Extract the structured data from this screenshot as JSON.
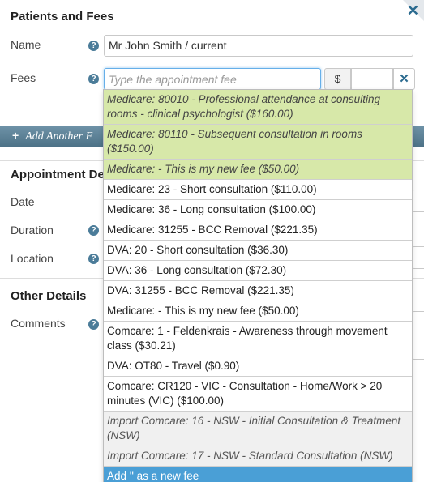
{
  "panel": {
    "title": "Patients and Fees",
    "close_icon": "close-icon"
  },
  "name_field": {
    "label": "Name",
    "value": "Mr John Smith / current"
  },
  "fees_field": {
    "label": "Fees",
    "placeholder": "Type the appointment fee",
    "currency": "$",
    "amount": ""
  },
  "add_bar": {
    "label": "Add Another F"
  },
  "appointment": {
    "title": "Appointment De",
    "date_label": "Date",
    "duration_label": "Duration",
    "location_label": "Location"
  },
  "other": {
    "title": "Other Details",
    "comments_label": "Comments"
  },
  "colors": {
    "accent": "#2a6a8f",
    "recent_bg": "#d7e8a9",
    "highlight_bg": "#4a9fd6",
    "bar_bg": "#5b7f94"
  },
  "dropdown": {
    "items": [
      {
        "text": "Medicare: 80010 - Professional attendance at consulting rooms - clinical psychologist ($160.00)",
        "kind": "recent"
      },
      {
        "text": "Medicare: 80110 - Subsequent consultation in rooms ($150.00)",
        "kind": "recent"
      },
      {
        "text": "Medicare: - This is my new fee ($50.00)",
        "kind": "recent"
      },
      {
        "text": "Medicare: 23 - Short consultation ($110.00)",
        "kind": "normal"
      },
      {
        "text": "Medicare: 36 - Long consultation ($100.00)",
        "kind": "normal"
      },
      {
        "text": "Medicare: 31255 - BCC Removal ($221.35)",
        "kind": "normal"
      },
      {
        "text": "DVA: 20 - Short consultation ($36.30)",
        "kind": "normal"
      },
      {
        "text": "DVA: 36 - Long consultation ($72.30)",
        "kind": "normal"
      },
      {
        "text": "DVA: 31255 - BCC Removal ($221.35)",
        "kind": "normal"
      },
      {
        "text": "Medicare: - This is my new fee ($50.00)",
        "kind": "normal"
      },
      {
        "text": "Comcare: 1 - Feldenkrais - Awareness through movement class ($30.21)",
        "kind": "normal"
      },
      {
        "text": "DVA: OT80 - Travel ($0.90)",
        "kind": "normal"
      },
      {
        "text": "Comcare: CR120 - VIC - Consultation - Home/Work > 20 minutes (VIC) ($100.00)",
        "kind": "normal"
      },
      {
        "text": "Import Comcare: 16 - NSW - Initial Consultation & Treatment (NSW)",
        "kind": "imported"
      },
      {
        "text": "Import Comcare: 17 - NSW - Standard Consultation (NSW)",
        "kind": "imported"
      },
      {
        "text": "Add '' as a new fee",
        "kind": "add-new"
      }
    ]
  }
}
